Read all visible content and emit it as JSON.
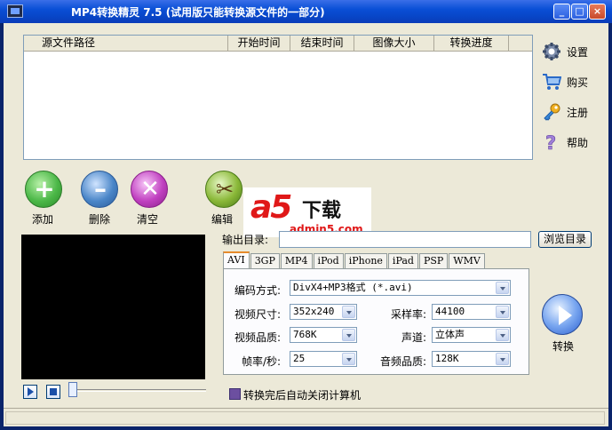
{
  "window": {
    "title": "MP4转换精灵 7.5 (试用版只能转换源文件的一部分)"
  },
  "file_list": {
    "columns": [
      "源文件路径",
      "开始时间",
      "结束时间",
      "图像大小",
      "转换进度"
    ],
    "rows": []
  },
  "sidebar": [
    {
      "label": "设置",
      "icon": "gear-icon"
    },
    {
      "label": "购买",
      "icon": "cart-icon"
    },
    {
      "label": "注册",
      "icon": "key-icon"
    },
    {
      "label": "帮助",
      "icon": "help-icon"
    }
  ],
  "actions": {
    "add": "添加",
    "remove": "删除",
    "clear": "清空",
    "edit": "编辑"
  },
  "watermark": {
    "a5": "a5",
    "xz": "下载",
    "url": "admin5.com"
  },
  "output": {
    "label": "输出目录:",
    "value": "",
    "browse": "浏览目录"
  },
  "tabs": [
    "AVI",
    "3GP",
    "MP4",
    "iPod",
    "iPhone",
    "iPad",
    "PSP",
    "WMV"
  ],
  "active_tab": "AVI",
  "settings": {
    "encoding": {
      "label": "编码方式:",
      "value": "DivX4+MP3格式 (*.avi)"
    },
    "video_size": {
      "label": "视频尺寸:",
      "value": "352x240"
    },
    "video_quality": {
      "label": "视频品质:",
      "value": "768K"
    },
    "fps": {
      "label": "帧率/秒:",
      "value": "25"
    },
    "sample_rate": {
      "label": "采样率:",
      "value": "44100"
    },
    "channel": {
      "label": "声道:",
      "value": "立体声"
    },
    "audio_quality": {
      "label": "音频品质:",
      "value": "128K"
    }
  },
  "convert": {
    "label": "转换"
  },
  "auto_shutdown": {
    "label": "转换完后自动关闭计算机",
    "checked": true
  },
  "colors": {
    "title_bar": "#0a4fd6",
    "client_bg": "#ece9d8",
    "add": "#4cb848",
    "remove": "#4a86c8",
    "clear": "#c040c0"
  }
}
